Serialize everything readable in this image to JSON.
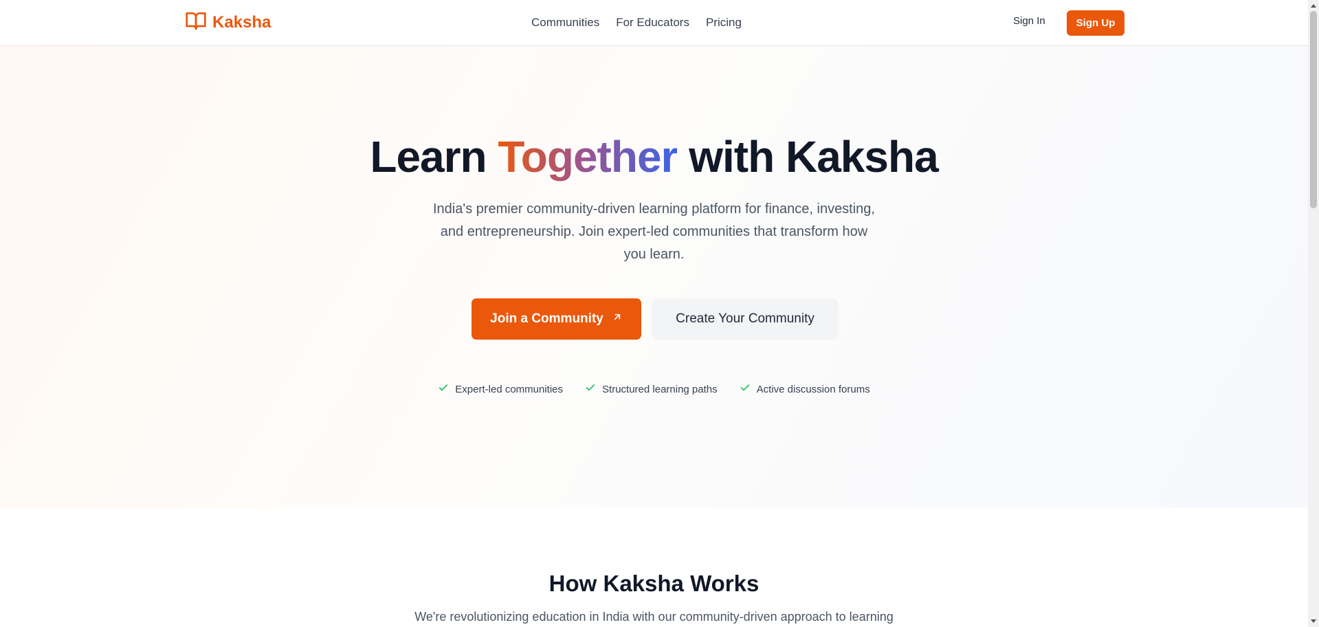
{
  "brand": {
    "name": "Kaksha",
    "icon": "open-book-icon",
    "color": "#ea580c"
  },
  "nav": {
    "items": [
      {
        "label": "Communities"
      },
      {
        "label": "For Educators"
      },
      {
        "label": "Pricing"
      }
    ],
    "sign_in": "Sign In",
    "sign_up": "Sign Up"
  },
  "hero": {
    "title_before": "Learn",
    "title_accent": "Together",
    "title_after": "with Kaksha",
    "subtitle": "India's premier community-driven learning platform for finance, investing, and entrepreneurship. Join expert-led communities that transform how you learn.",
    "primary_cta": "Join a Community",
    "secondary_cta": "Create Your Community",
    "features": [
      {
        "label": "Expert-led communities",
        "icon": "check-icon"
      },
      {
        "label": "Structured learning paths",
        "icon": "check-icon"
      },
      {
        "label": "Active discussion forums",
        "icon": "check-icon"
      }
    ]
  },
  "how_it_works": {
    "title": "How Kaksha Works",
    "subtitle": "We're revolutionizing education in India with our community-driven approach to learning"
  },
  "colors": {
    "accent": "#ea580c",
    "accent_gradient_mid": "#a0558a",
    "accent_gradient_end": "#3b63e6",
    "check": "#22c55e",
    "text_dark": "#111827",
    "text_muted": "#4b5563"
  }
}
